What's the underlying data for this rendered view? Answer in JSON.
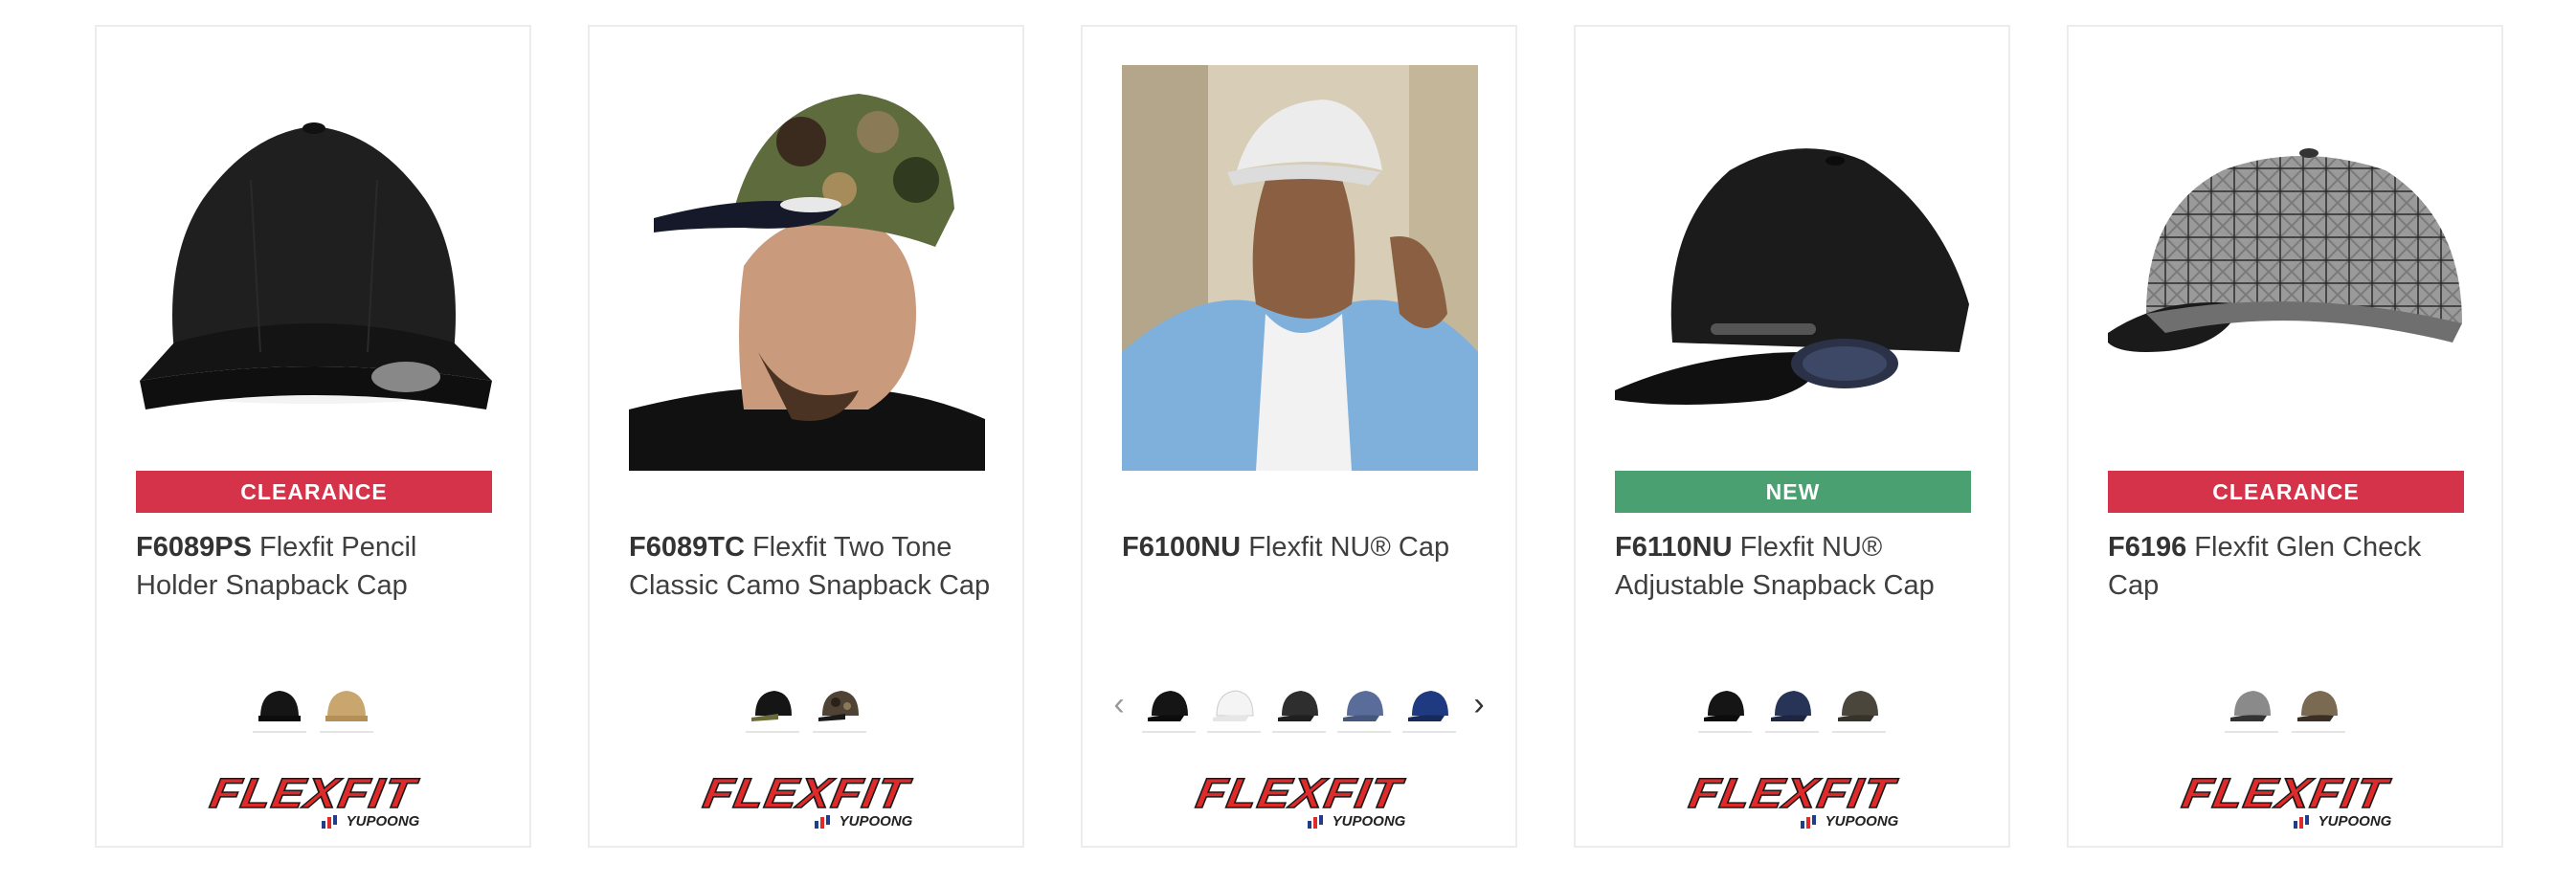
{
  "products": [
    {
      "code": "F6089PS",
      "name": "Flexfit Pencil Holder Snapback Cap",
      "badge": "CLEARANCE",
      "image": "black-snapback-cap",
      "swatches": [
        "black",
        "tan"
      ],
      "has_arrows": false
    },
    {
      "code": "F6089TC",
      "name": "Flexfit Two Tone Classic Camo Snapback Cap",
      "badge": "",
      "image": "man-wearing-camo-cap",
      "swatches": [
        "black-camo",
        "brown-camo"
      ],
      "has_arrows": false
    },
    {
      "code": "F6100NU",
      "name": "Flexfit NU® Cap",
      "badge": "",
      "image": "man-wearing-white-cap",
      "swatches": [
        "black",
        "white",
        "charcoal",
        "slate-blue",
        "navy"
      ],
      "has_arrows": true
    },
    {
      "code": "F6110NU",
      "name": "Flexfit NU® Adjustable Snapback Cap",
      "badge": "NEW",
      "image": "black-adjustable-cap",
      "swatches": [
        "black",
        "navy",
        "dark-olive"
      ],
      "has_arrows": false
    },
    {
      "code": "F6196",
      "name": "Flexfit Glen Check Cap",
      "badge": "CLEARANCE",
      "image": "glen-check-cap",
      "swatches": [
        "grey-check",
        "brown-check"
      ],
      "has_arrows": false
    }
  ],
  "brand": {
    "logo_text": "FLEXFIT",
    "logo_sub": "YUPOONG",
    "colors": {
      "logo_red": "#e02a2a",
      "clearance": "#d5334a",
      "new": "#4aa070"
    }
  },
  "icons": {
    "prev": "chevron-left-icon",
    "next": "chevron-right-icon"
  },
  "arrows": {
    "prev": "‹",
    "next": "›"
  }
}
